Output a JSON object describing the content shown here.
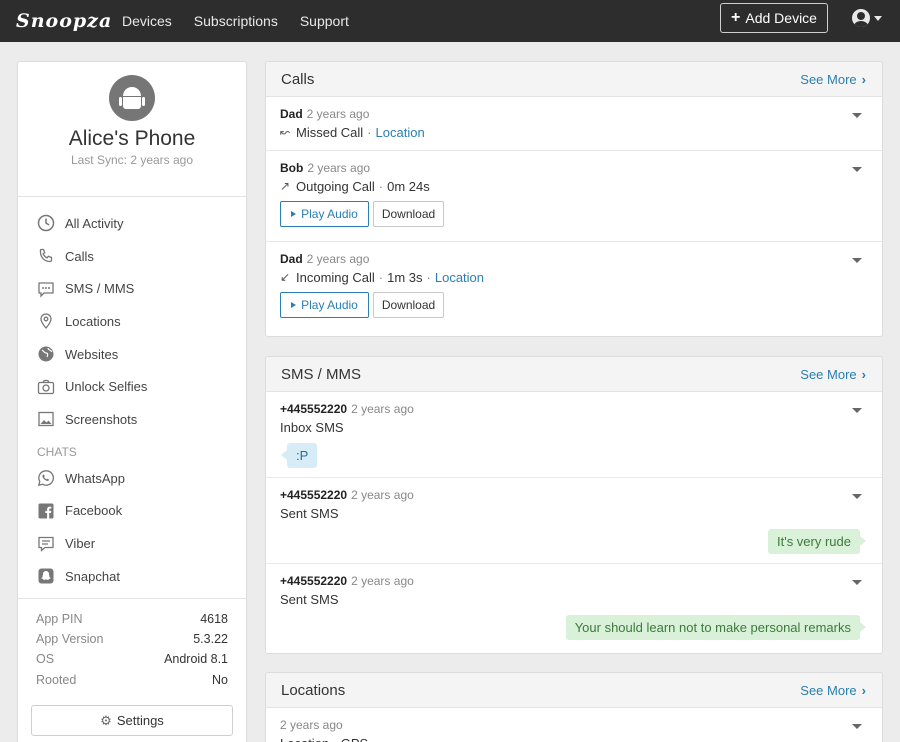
{
  "nav": {
    "logo": "Snoopza",
    "links": [
      "Devices",
      "Subscriptions",
      "Support"
    ],
    "add_device": "Add Device"
  },
  "device": {
    "name": "Alice's Phone",
    "last_sync": "Last Sync: 2 years ago"
  },
  "sidebar": {
    "items": [
      {
        "label": "All Activity",
        "icon": "clock-icon"
      },
      {
        "label": "Calls",
        "icon": "phone-icon"
      },
      {
        "label": "SMS / MMS",
        "icon": "chat-icon"
      },
      {
        "label": "Locations",
        "icon": "map-pin-icon"
      },
      {
        "label": "Websites",
        "icon": "globe-icon"
      },
      {
        "label": "Unlock Selfies",
        "icon": "camera-icon"
      },
      {
        "label": "Screenshots",
        "icon": "image-icon"
      }
    ],
    "chats_header": "CHATS",
    "chats": [
      {
        "label": "WhatsApp",
        "icon": "whatsapp-icon"
      },
      {
        "label": "Facebook",
        "icon": "facebook-icon"
      },
      {
        "label": "Viber",
        "icon": "viber-icon"
      },
      {
        "label": "Snapchat",
        "icon": "snapchat-icon"
      }
    ],
    "info": [
      {
        "key": "App PIN",
        "value": "4618"
      },
      {
        "key": "App Version",
        "value": "5.3.22"
      },
      {
        "key": "OS",
        "value": "Android 8.1"
      },
      {
        "key": "Rooted",
        "value": "No"
      }
    ],
    "settings": "Settings"
  },
  "calls": {
    "title": "Calls",
    "see_more": "See More",
    "entries": [
      {
        "who": "Dad",
        "time": "2 years ago",
        "type": "Missed Call",
        "sep": "·",
        "location": "Location"
      },
      {
        "who": "Bob",
        "time": "2 years ago",
        "type": "Outgoing Call",
        "sep": "·",
        "duration": "0m 24s",
        "play": "Play Audio",
        "download": "Download"
      },
      {
        "who": "Dad",
        "time": "2 years ago",
        "type": "Incoming Call",
        "sep": "·",
        "duration": "1m 3s",
        "sep2": "·",
        "location": "Location",
        "play": "Play Audio",
        "download": "Download"
      }
    ]
  },
  "sms": {
    "title": "SMS / MMS",
    "see_more": "See More",
    "entries": [
      {
        "who": "+445552220",
        "time": "2 years ago",
        "type": "Inbox SMS",
        "message": ":P"
      },
      {
        "who": "+445552220",
        "time": "2 years ago",
        "type": "Sent SMS",
        "message": "It's very rude"
      },
      {
        "who": "+445552220",
        "time": "2 years ago",
        "type": "Sent SMS",
        "message": "Your should learn not to make personal remarks"
      }
    ]
  },
  "locations": {
    "title": "Locations",
    "see_more": "See More",
    "entries": [
      {
        "time": "2 years ago",
        "type": "Location · GPS"
      }
    ]
  },
  "colors": {
    "navbar": "#2d2d2d",
    "link": "#2a7fb0",
    "bubble_in": "#d6ecf7",
    "bubble_out": "#d9f0d9"
  }
}
